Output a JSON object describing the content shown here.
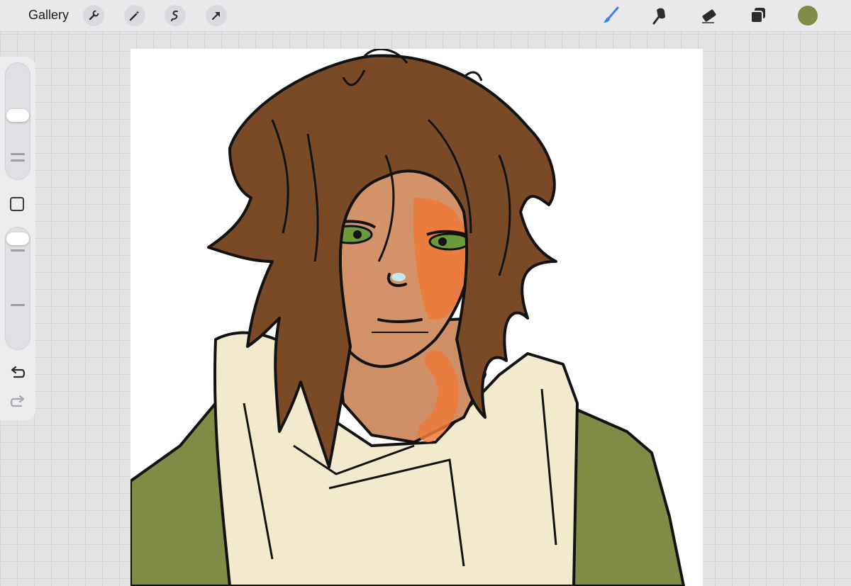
{
  "topbar": {
    "gallery_label": "Gallery",
    "left_tools": [
      "wrench-icon",
      "magic-wand-icon",
      "selection-icon",
      "transform-arrow-icon"
    ],
    "right_tools": [
      "brush-icon",
      "smudge-icon",
      "eraser-icon",
      "layers-icon"
    ],
    "active_tool": "brush-icon",
    "active_tool_color": "#3b82f0",
    "current_color": "#7f8c45"
  },
  "sidebar": {
    "brush_size_level": 0.6,
    "opacity_level": 0.95,
    "controls": [
      "brush-size-slider",
      "modify-button",
      "opacity-slider",
      "undo-icon",
      "redo-icon"
    ]
  },
  "canvas": {
    "artwork": "illustration"
  },
  "colors": {
    "hair": "#7a4a26",
    "skin": "#d49268",
    "blush": "#ec7a3a",
    "eyes": "#6a9a3a",
    "jacket": "#7f8c45",
    "collar": "#f3e9cc",
    "outline": "#121212"
  }
}
